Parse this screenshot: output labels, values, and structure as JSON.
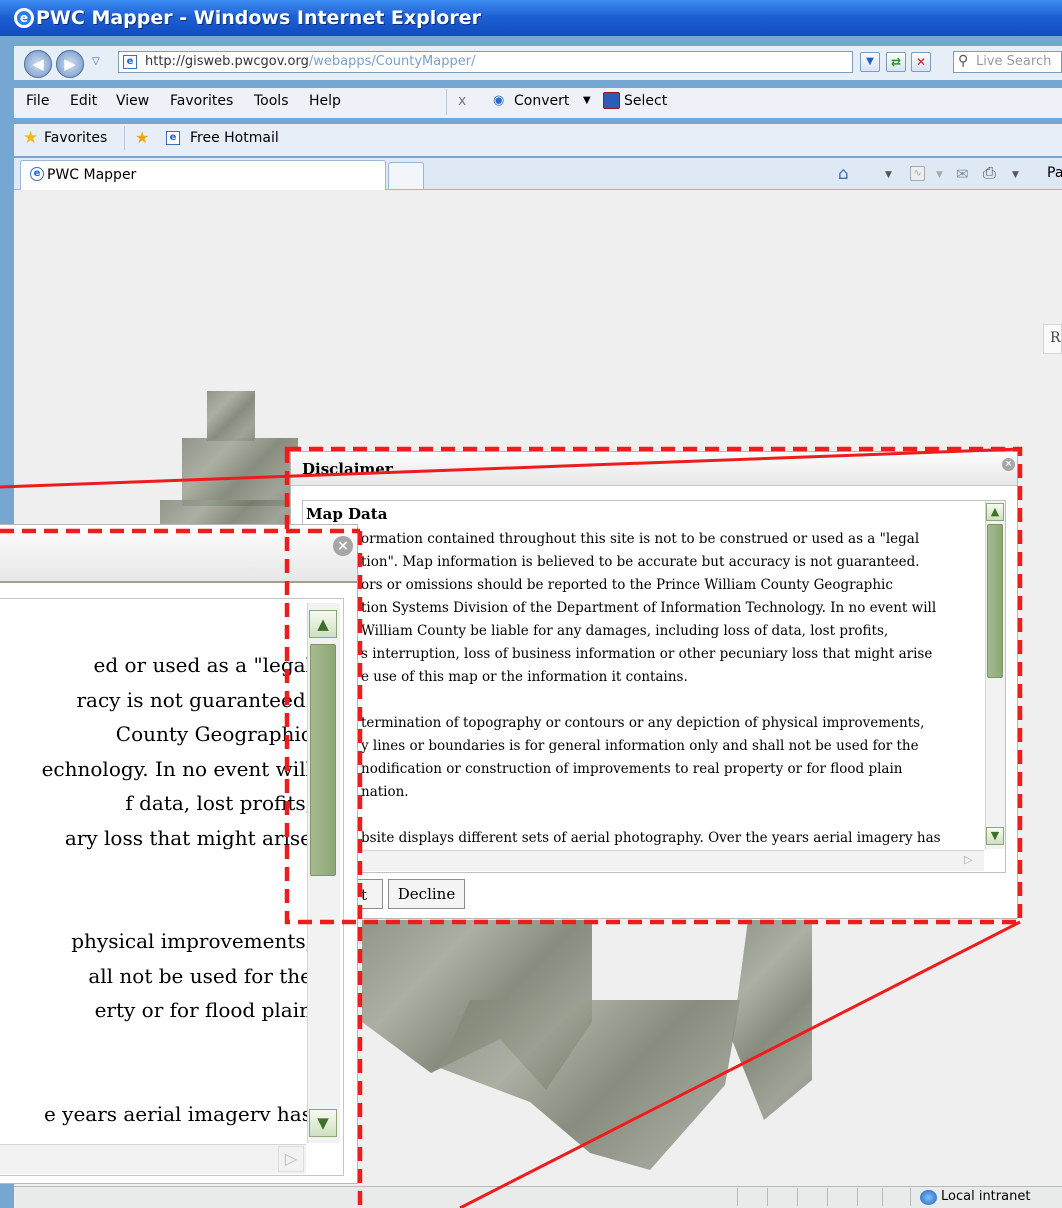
{
  "window": {
    "title": "PWC Mapper - Windows Internet Explorer"
  },
  "address": {
    "url_domain": "http://gisweb.pwcgov.org",
    "url_path": "/webapps/CountyMapper/",
    "search_placeholder": "Live Search"
  },
  "menus": [
    "File",
    "Edit",
    "View",
    "Favorites",
    "Tools",
    "Help"
  ],
  "toolbar": {
    "convert_label": "Convert",
    "select_label": "Select"
  },
  "favorites": {
    "favorites_label": "Favorites",
    "hotmail_label": "Free Hotmail"
  },
  "tab": {
    "label": "PWC Mapper"
  },
  "cmdbar": {
    "page_label": "Pa"
  },
  "side_label": "R",
  "status": {
    "zone_label": "Local intranet"
  },
  "dialog": {
    "title": "Disclaimer",
    "heading": "Map Data",
    "lines": [
      "ormation contained throughout this site is not to be construed or used as a \"legal",
      "tion\". Map information is believed to be accurate but accuracy is not guaranteed.",
      "ors or omissions should be reported to the Prince William County Geographic",
      "tion Systems Division of the Department of Information Technology. In no event will",
      "William County be liable for any damages, including loss of data, lost profits,",
      "s interruption, loss of business information or other pecuniary loss that might arise",
      "e use of this map or the information it contains.",
      "",
      "termination of topography or contours or any depiction of physical improvements,",
      "y lines or boundaries is for general information only and shall not be used for the",
      "nodification or construction of improvements to real property or for flood plain",
      "nation.",
      "",
      "bsite displays different sets of aerial photography. Over the years aerial imagery has"
    ],
    "accept_partial": "t",
    "decline_label": "Decline"
  },
  "zoom": {
    "lines": [
      "ed or used as a \"legal",
      "racy is not guaranteed.",
      " County Geographic",
      "echnology. In no event will",
      "f data, lost profits,",
      "ary loss that might arise",
      "",
      "",
      "physical improvements,",
      "all not be used for the",
      "erty or for flood plain",
      "",
      "",
      "e years aerial imagerv has"
    ]
  },
  "colors": {
    "highlight": "#ee1c1c",
    "ie_title": "#1f60d4",
    "scroll_green": "#8ca675"
  }
}
